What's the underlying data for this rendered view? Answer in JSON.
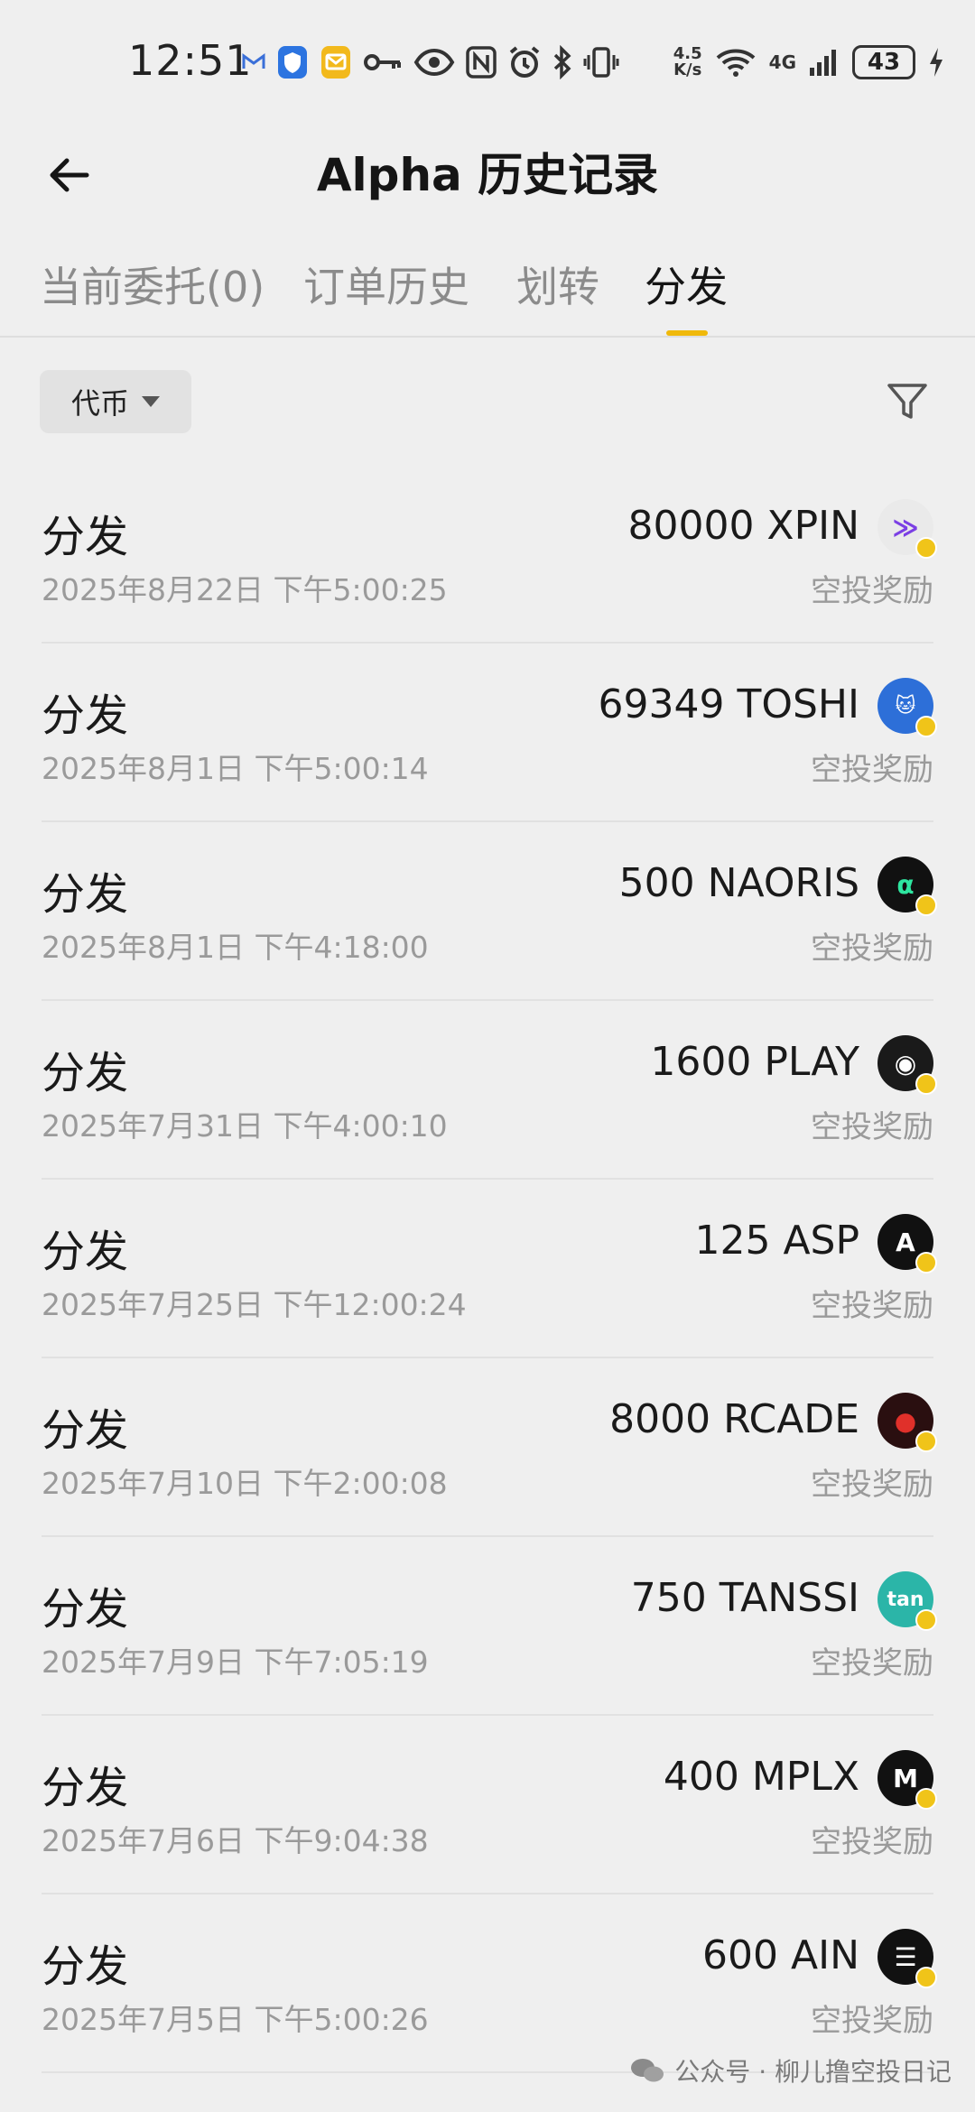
{
  "status_bar": {
    "time": "12:51",
    "speed_top": "4.5",
    "speed_bottom": "K/s",
    "network": "4G",
    "battery": "43",
    "icons": [
      "mail-m-icon",
      "shield-icon",
      "message-icon",
      "key-icon",
      "eye-icon",
      "nfc-icon",
      "alarm-icon",
      "bluetooth-icon",
      "vibrate-icon",
      "wifi-icon",
      "signal-icon",
      "charging-icon"
    ]
  },
  "header": {
    "title": "Alpha 历史记录"
  },
  "tabs": [
    {
      "label": "当前委托(0)",
      "active": false
    },
    {
      "label": "订单历史",
      "active": false
    },
    {
      "label": "划转",
      "active": false
    },
    {
      "label": "分发",
      "active": true
    }
  ],
  "filter": {
    "chip_label": "代币"
  },
  "records": [
    {
      "label": "分发",
      "date": "2025年8月22日 下午5:00:25",
      "amount": "80000 XPIN",
      "type": "空投奖励",
      "coin_bg": "#eaeaea",
      "coin_fg": "#7b3fe4",
      "coin_glyph": "≫"
    },
    {
      "label": "分发",
      "date": "2025年8月1日 下午5:00:14",
      "amount": "69349 TOSHI",
      "type": "空投奖励",
      "coin_bg": "#2d6fd8",
      "coin_fg": "#ffffff",
      "coin_glyph": "🐱"
    },
    {
      "label": "分发",
      "date": "2025年8月1日 下午4:18:00",
      "amount": "500 NAORIS",
      "type": "空投奖励",
      "coin_bg": "#111111",
      "coin_fg": "#2ee6a0",
      "coin_glyph": "α"
    },
    {
      "label": "分发",
      "date": "2025年7月31日 下午4:00:10",
      "amount": "1600 PLAY",
      "type": "空投奖励",
      "coin_bg": "#1a1a1a",
      "coin_fg": "#ffffff",
      "coin_glyph": "◉"
    },
    {
      "label": "分发",
      "date": "2025年7月25日 下午12:00:24",
      "amount": "125 ASP",
      "type": "空投奖励",
      "coin_bg": "#111111",
      "coin_fg": "#ffffff",
      "coin_glyph": "A"
    },
    {
      "label": "分发",
      "date": "2025年7月10日 下午2:00:08",
      "amount": "8000 RCADE",
      "type": "空投奖励",
      "coin_bg": "#2a0f10",
      "coin_fg": "#e0302a",
      "coin_glyph": "●"
    },
    {
      "label": "分发",
      "date": "2025年7月9日 下午7:05:19",
      "amount": "750 TANSSI",
      "type": "空投奖励",
      "coin_bg": "#2bb5a8",
      "coin_fg": "#ffffff",
      "coin_glyph": "tan"
    },
    {
      "label": "分发",
      "date": "2025年7月6日 下午9:04:38",
      "amount": "400 MPLX",
      "type": "空投奖励",
      "coin_bg": "#111111",
      "coin_fg": "#ffffff",
      "coin_glyph": "M"
    },
    {
      "label": "分发",
      "date": "2025年7月5日 下午5:00:26",
      "amount": "600 AIN",
      "type": "空投奖励",
      "coin_bg": "#111111",
      "coin_fg": "#ffffff",
      "coin_glyph": "☰"
    }
  ],
  "watermark": {
    "text": "公众号 · 柳儿撸空投日记"
  },
  "colors": {
    "accent": "#f0b90b",
    "background": "#efefef",
    "muted_text": "#9a9a9a"
  }
}
